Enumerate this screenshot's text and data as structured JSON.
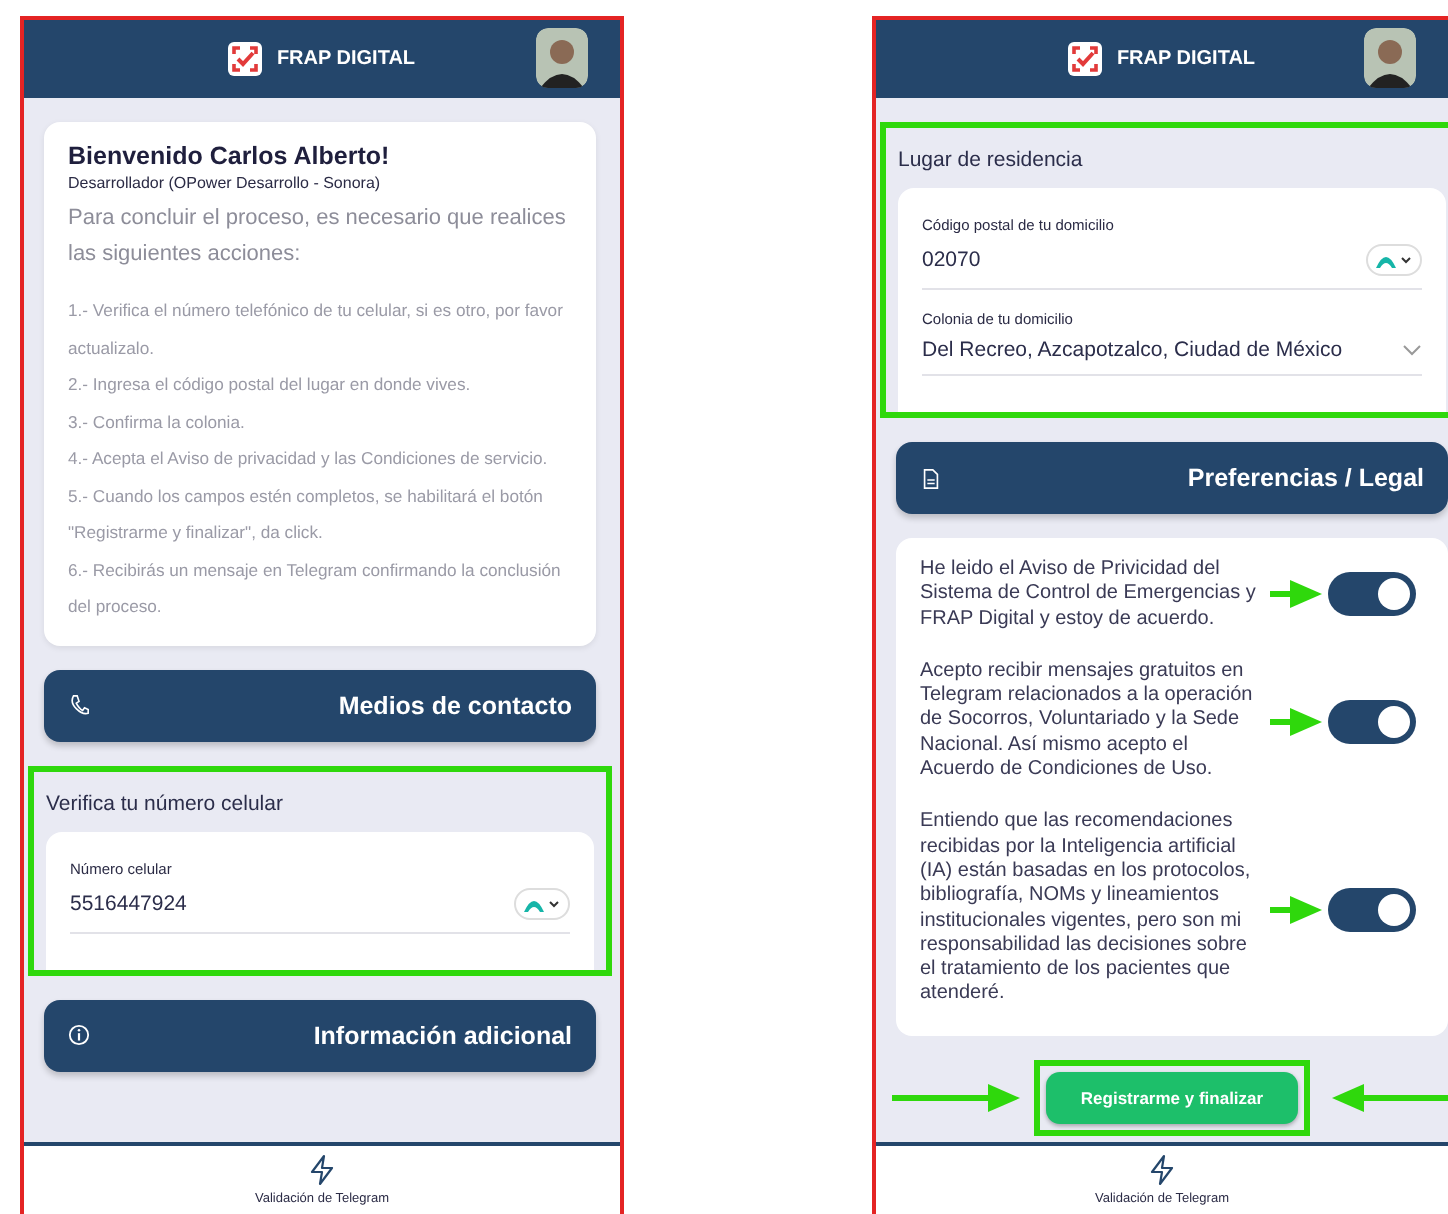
{
  "phones": [
    {
      "header": {
        "title": "FRAP DIGITAL"
      },
      "sections": [
        {
          "kind": "welcome",
          "title": "Bienvenido Carlos Alberto!",
          "subtitle": "Desarrollador (OPower Desarrollo - Sonora)",
          "intro": "Para concluir el proceso, es necesario que realices las siguientes acciones:",
          "steps": [
            "1.- Verifica el número telefónico de tu celular, si es otro, por favor actualizalo.",
            "2.- Ingresa el código postal del lugar en donde vives.",
            "3.- Confirma la colonia.",
            "4.- Acepta el Aviso de privacidad y las Condiciones de servicio.",
            "5.- Cuando los campos estén completos, se habilitará el botón \"Registrarme y finalizar\", da click.",
            "6.- Recibirás un mensaje en Telegram confirmando la conclusión del proceso."
          ]
        },
        {
          "kind": "accordion",
          "title": "Medios de contacto"
        },
        {
          "kind": "form",
          "title": "Verifica tu número celular",
          "highlighted": true,
          "fields": [
            {
              "kind": "verified",
              "label": "Número celular",
              "value": "5516447924"
            }
          ]
        },
        {
          "kind": "accordion",
          "title": "Información adicional"
        }
      ],
      "nav": {
        "label": "Validación de Telegram"
      }
    },
    {
      "header": {
        "title": "FRAP DIGITAL"
      },
      "sections": [
        {
          "kind": "form",
          "title": "Lugar de residencia",
          "highlighted": true,
          "fields": [
            {
              "kind": "verified",
              "label": "Código postal de tu domicilio",
              "value": "02070"
            },
            {
              "kind": "select",
              "label": "Colonia de tu domicilio",
              "value": "Del Recreo, Azcapotzalco, Ciudad de México"
            }
          ]
        },
        {
          "kind": "accordion",
          "title": "Preferencias / Legal"
        },
        {
          "kind": "consents",
          "items": [
            {
              "text": "He leido el Aviso de Privicidad del Sistema de Control de Emergencias y FRAP Digital y estoy de acuerdo.",
              "on": true,
              "pointed": true
            },
            {
              "text": "Acepto recibir mensajes gratuitos en Telegram relacionados a la operación de Socorros, Voluntariado y la Sede Nacional. Así mismo acepto el Acuerdo de Condiciones de Uso.",
              "on": true,
              "pointed": true
            },
            {
              "text": "Entiendo que las recomendaciones recibidas por la Inteligencia artificial (IA) están basadas en los protocolos, bibliografía, NOMs y lineamientos institucionales vigentes, pero son mi responsabilidad las decisiones sobre el tratamiento de los pacientes que atenderé.",
              "on": true,
              "pointed": true
            }
          ]
        },
        {
          "kind": "submit",
          "label": "Registrarme y finalizar",
          "highlighted": true
        }
      ],
      "nav": {
        "label": "Validación de Telegram"
      }
    }
  ]
}
